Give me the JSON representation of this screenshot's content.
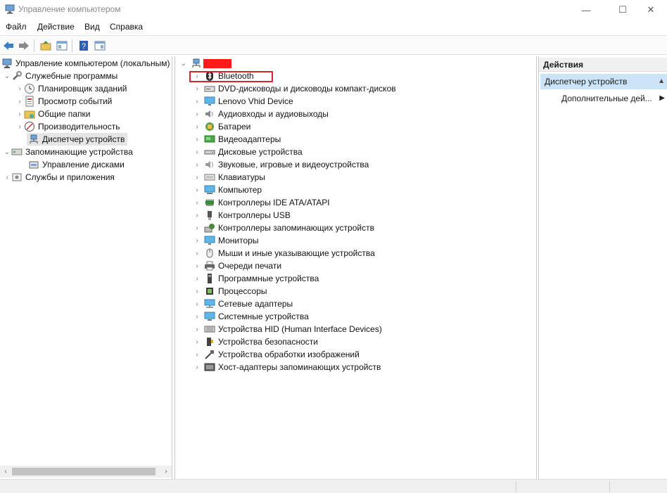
{
  "window": {
    "title": "Управление компьютером",
    "min_glyph": "—",
    "max_glyph": "☐",
    "close_glyph": "✕"
  },
  "menu": {
    "file": "Файл",
    "action": "Действие",
    "view": "Вид",
    "help": "Справка"
  },
  "toolbar": {
    "icons": [
      "back-arrow-icon",
      "forward-arrow-icon",
      "up-folder-icon",
      "console-tree-icon",
      "help-icon",
      "properties-icon"
    ]
  },
  "left_tree": {
    "root": "Управление компьютером (локальным)",
    "utilities": "Служебные программы",
    "task_scheduler": "Планировщик заданий",
    "event_viewer": "Просмотр событий",
    "shared_folders": "Общие папки",
    "performance": "Производительность",
    "device_manager": "Диспетчер устройств",
    "storage": "Запоминающие устройства",
    "disk_management": "Управление дисками",
    "services_apps": "Службы и приложения"
  },
  "devices": {
    "computer_name": "",
    "categories": [
      {
        "label": "Bluetooth",
        "icon": "bluetooth-icon"
      },
      {
        "label": "DVD-дисководы и дисководы компакт-дисков",
        "icon": "dvd-drive-icon"
      },
      {
        "label": "Lenovo Vhid Device",
        "icon": "monitor-icon"
      },
      {
        "label": "Аудиовходы и аудиовыходы",
        "icon": "speaker-icon"
      },
      {
        "label": "Батареи",
        "icon": "battery-icon"
      },
      {
        "label": "Видеоадаптеры",
        "icon": "display-adapter-icon"
      },
      {
        "label": "Дисковые устройства",
        "icon": "disk-drive-icon"
      },
      {
        "label": "Звуковые, игровые и видеоустройства",
        "icon": "sound-icon"
      },
      {
        "label": "Клавиатуры",
        "icon": "keyboard-icon"
      },
      {
        "label": "Компьютер",
        "icon": "computer-icon"
      },
      {
        "label": "Контроллеры IDE ATA/ATAPI",
        "icon": "ide-controller-icon"
      },
      {
        "label": "Контроллеры USB",
        "icon": "usb-icon"
      },
      {
        "label": "Контроллеры запоминающих устройств",
        "icon": "storage-controller-icon"
      },
      {
        "label": "Мониторы",
        "icon": "monitor-icon"
      },
      {
        "label": "Мыши и иные указывающие устройства",
        "icon": "mouse-icon"
      },
      {
        "label": "Очереди печати",
        "icon": "printer-icon"
      },
      {
        "label": "Программные устройства",
        "icon": "software-device-icon"
      },
      {
        "label": "Процессоры",
        "icon": "processor-icon"
      },
      {
        "label": "Сетевые адаптеры",
        "icon": "network-adapter-icon"
      },
      {
        "label": "Системные устройства",
        "icon": "system-device-icon"
      },
      {
        "label": "Устройства HID (Human Interface Devices)",
        "icon": "hid-icon"
      },
      {
        "label": "Устройства безопасности",
        "icon": "security-device-icon"
      },
      {
        "label": "Устройства обработки изображений",
        "icon": "imaging-device-icon"
      },
      {
        "label": "Хост-адаптеры запоминающих устройств",
        "icon": "host-adapter-icon"
      }
    ]
  },
  "actions": {
    "header": "Действия",
    "section": "Диспетчер устройств",
    "more": "Дополнительные дей..."
  },
  "colors": {
    "highlight_box": "#d9232e",
    "selection": "#cce4f7",
    "tree_selected": "#e5e5e5"
  }
}
